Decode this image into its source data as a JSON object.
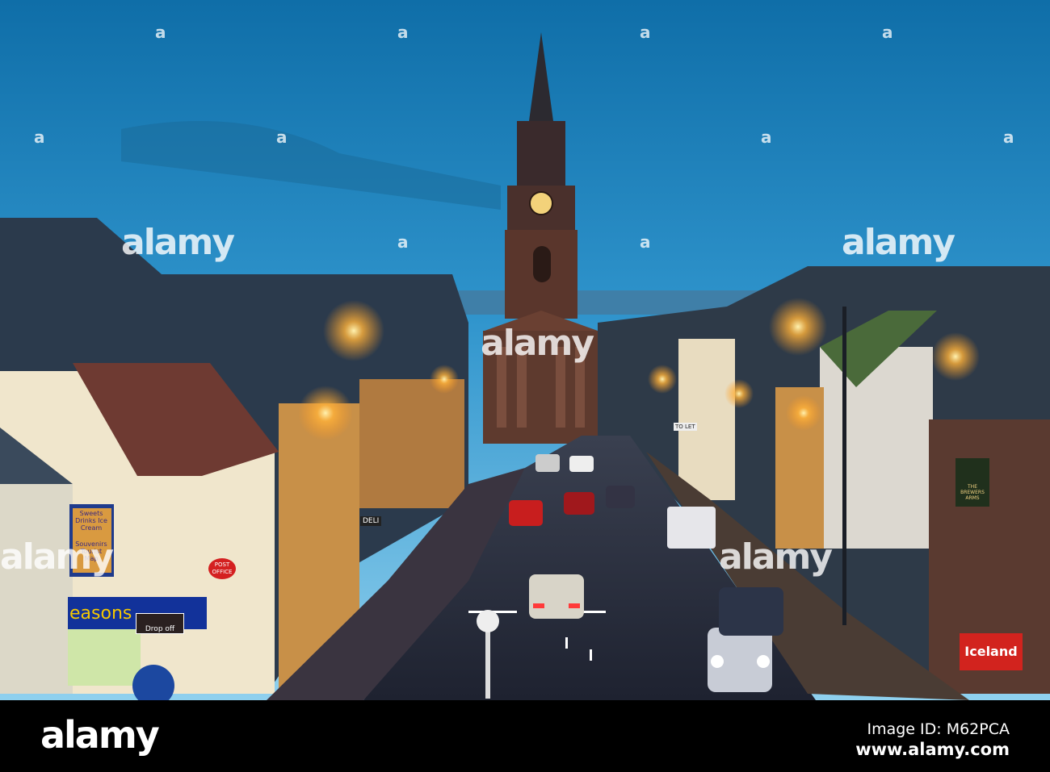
{
  "photo": {
    "subject": "Town hall clock tower and high street at dusk",
    "signs": {
      "shop_panel_1": "Sweets Drinks Ice Cream",
      "shop_panel_2": "Souvenirs Tourist Map",
      "post_office": "POST OFFICE",
      "shop_name": "easons",
      "drop_off": "Drop off",
      "deli": "DELI",
      "to_let": "TO LET",
      "pub": "THE BREWERS ARMS",
      "supermarket": "Iceland"
    },
    "colors": {
      "sky_top": "#137ab8",
      "sky_horizon": "#7ec8ea",
      "stone": "#5e3a2e",
      "lamp": "#ffc24a"
    }
  },
  "watermark": {
    "text": "alamy",
    "tile": "a"
  },
  "footer": {
    "logo": "alamy",
    "image_id": "Image ID: M62PCA",
    "url": "www.alamy.com"
  }
}
